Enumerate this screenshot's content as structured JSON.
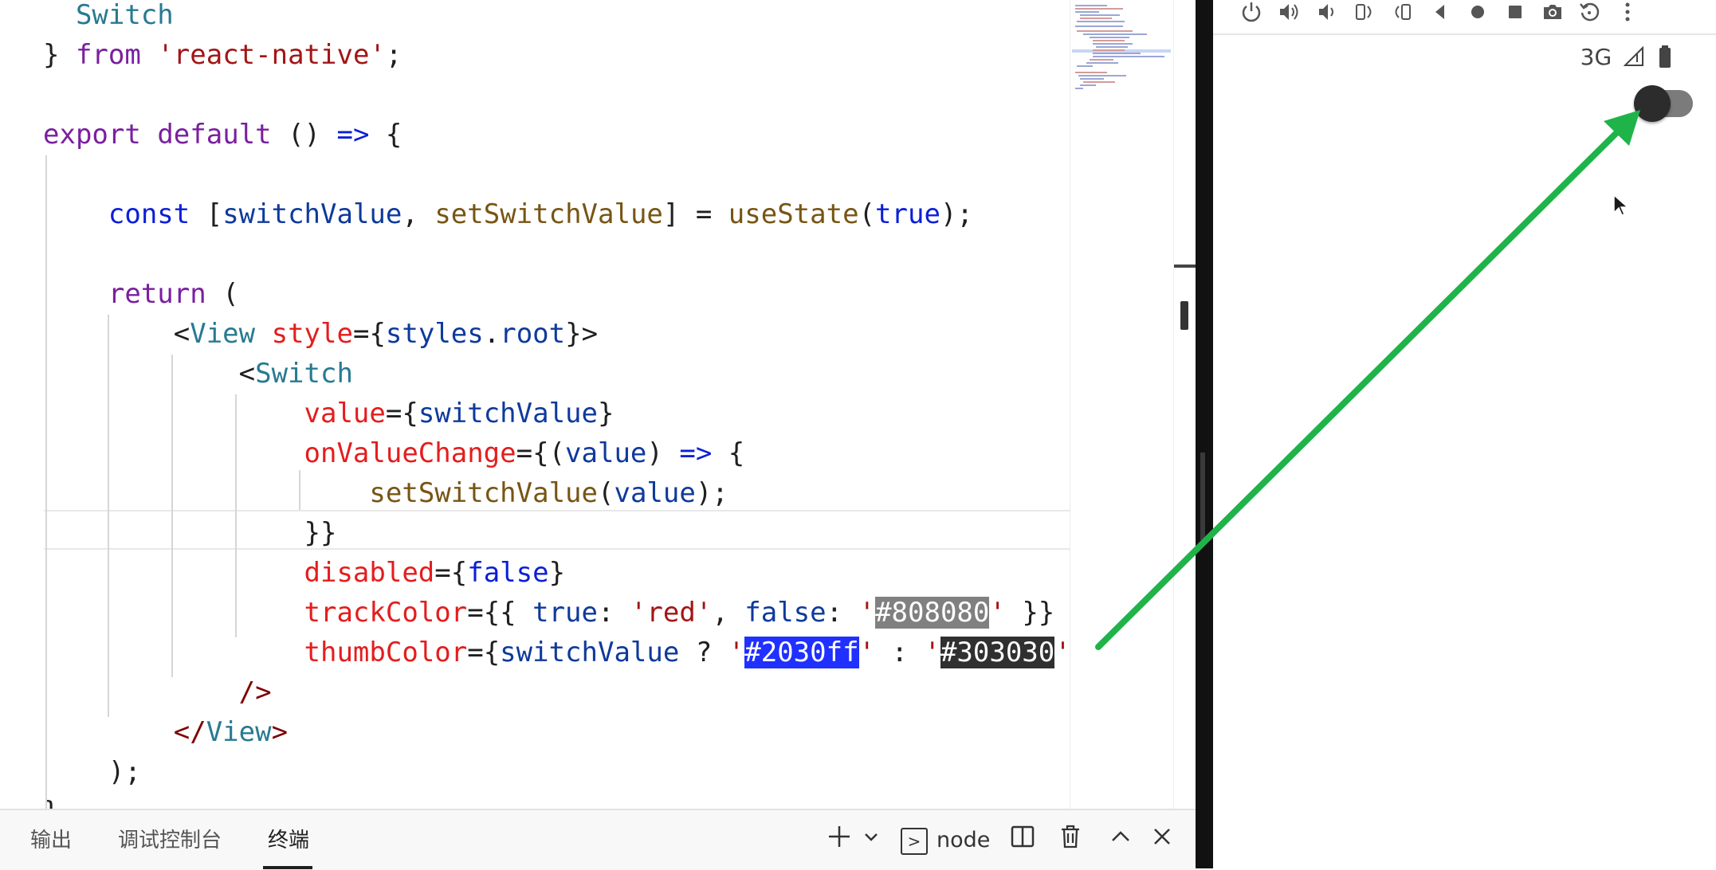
{
  "editor": {
    "lines": [
      {
        "segs": [
          {
            "t": "  Switch",
            "c": "t-comp"
          }
        ]
      },
      {
        "segs": [
          {
            "t": "} ",
            "c": "t-punc"
          },
          {
            "t": "from",
            "c": "t-kw"
          },
          {
            "t": " ",
            "c": "t-punc"
          },
          {
            "t": "'react-native'",
            "c": "t-str"
          },
          {
            "t": ";",
            "c": "t-punc"
          }
        ]
      },
      {
        "segs": []
      },
      {
        "segs": [
          {
            "t": "export",
            "c": "t-kw"
          },
          {
            "t": " ",
            "c": "t-punc"
          },
          {
            "t": "default",
            "c": "t-kw"
          },
          {
            "t": " () ",
            "c": "t-punc"
          },
          {
            "t": "=>",
            "c": "t-def"
          },
          {
            "t": " {",
            "c": "t-punc"
          }
        ]
      },
      {
        "segs": []
      },
      {
        "segs": [
          {
            "t": "    ",
            "c": "t-punc"
          },
          {
            "t": "const",
            "c": "t-def"
          },
          {
            "t": " [",
            "c": "t-punc"
          },
          {
            "t": "switchValue",
            "c": "t-var"
          },
          {
            "t": ", ",
            "c": "t-punc"
          },
          {
            "t": "setSwitchValue",
            "c": "t-fn"
          },
          {
            "t": "] = ",
            "c": "t-punc"
          },
          {
            "t": "useState",
            "c": "t-fn"
          },
          {
            "t": "(",
            "c": "t-punc"
          },
          {
            "t": "true",
            "c": "t-bool"
          },
          {
            "t": ");",
            "c": "t-punc"
          }
        ]
      },
      {
        "segs": []
      },
      {
        "segs": [
          {
            "t": "    ",
            "c": "t-punc"
          },
          {
            "t": "return",
            "c": "t-kw"
          },
          {
            "t": " (",
            "c": "t-punc"
          }
        ]
      },
      {
        "segs": [
          {
            "t": "        <",
            "c": "t-punc"
          },
          {
            "t": "View",
            "c": "t-comp"
          },
          {
            "t": " ",
            "c": "t-punc"
          },
          {
            "t": "style",
            "c": "t-attr"
          },
          {
            "t": "={",
            "c": "t-punc"
          },
          {
            "t": "styles",
            "c": "t-var"
          },
          {
            "t": ".",
            "c": "t-punc"
          },
          {
            "t": "root",
            "c": "t-var"
          },
          {
            "t": "}>",
            "c": "t-punc"
          }
        ]
      },
      {
        "segs": [
          {
            "t": "            <",
            "c": "t-punc"
          },
          {
            "t": "Switch",
            "c": "t-comp"
          }
        ]
      },
      {
        "segs": [
          {
            "t": "                ",
            "c": "t-punc"
          },
          {
            "t": "value",
            "c": "t-attr"
          },
          {
            "t": "={",
            "c": "t-punc"
          },
          {
            "t": "switchValue",
            "c": "t-var"
          },
          {
            "t": "}",
            "c": "t-punc"
          }
        ]
      },
      {
        "segs": [
          {
            "t": "                ",
            "c": "t-punc"
          },
          {
            "t": "onValueChange",
            "c": "t-attr"
          },
          {
            "t": "={(",
            "c": "t-punc"
          },
          {
            "t": "value",
            "c": "t-var"
          },
          {
            "t": ") ",
            "c": "t-punc"
          },
          {
            "t": "=>",
            "c": "t-def"
          },
          {
            "t": " {",
            "c": "t-punc"
          }
        ]
      },
      {
        "segs": [
          {
            "t": "                    ",
            "c": "t-punc"
          },
          {
            "t": "setSwitchValue",
            "c": "t-fn"
          },
          {
            "t": "(",
            "c": "t-punc"
          },
          {
            "t": "value",
            "c": "t-var"
          },
          {
            "t": ");",
            "c": "t-punc"
          }
        ]
      },
      {
        "segs": [
          {
            "t": "                }}",
            "c": "t-punc"
          }
        ]
      },
      {
        "segs": [
          {
            "t": "                ",
            "c": "t-punc"
          },
          {
            "t": "disabled",
            "c": "t-attr"
          },
          {
            "t": "={",
            "c": "t-punc"
          },
          {
            "t": "false",
            "c": "t-bool"
          },
          {
            "t": "}",
            "c": "t-punc"
          }
        ]
      },
      {
        "segs": [
          {
            "t": "                ",
            "c": "t-punc"
          },
          {
            "t": "trackColor",
            "c": "t-attr"
          },
          {
            "t": "={{ ",
            "c": "t-punc"
          },
          {
            "t": "true",
            "c": "t-var"
          },
          {
            "t": ": ",
            "c": "t-punc"
          },
          {
            "t": "'red'",
            "c": "t-str"
          },
          {
            "t": ", ",
            "c": "t-punc"
          },
          {
            "t": "false",
            "c": "t-var"
          },
          {
            "t": ": ",
            "c": "t-punc"
          },
          {
            "t": "'",
            "c": "t-str"
          },
          {
            "t": "#808080",
            "c": "hl-gray"
          },
          {
            "t": "'",
            "c": "t-str"
          },
          {
            "t": " }}",
            "c": "t-punc"
          }
        ]
      },
      {
        "segs": [
          {
            "t": "                ",
            "c": "t-punc"
          },
          {
            "t": "thumbColor",
            "c": "t-attr"
          },
          {
            "t": "={",
            "c": "t-punc"
          },
          {
            "t": "switchValue",
            "c": "t-var"
          },
          {
            "t": " ? ",
            "c": "t-punc"
          },
          {
            "t": "'",
            "c": "t-str"
          },
          {
            "t": "#2030ff",
            "c": "hl-blue"
          },
          {
            "t": "'",
            "c": "t-str"
          },
          {
            "t": " : ",
            "c": "t-punc"
          },
          {
            "t": "'",
            "c": "t-str"
          },
          {
            "t": "#303030",
            "c": "hl-dark"
          },
          {
            "t": "'",
            "c": "t-str"
          },
          {
            "t": "}",
            "c": "t-punc"
          }
        ]
      },
      {
        "segs": [
          {
            "t": "            />",
            "c": "t-tag"
          }
        ]
      },
      {
        "segs": [
          {
            "t": "        </",
            "c": "t-tag"
          },
          {
            "t": "View",
            "c": "t-comp"
          },
          {
            "t": ">",
            "c": "t-tag"
          }
        ]
      },
      {
        "segs": [
          {
            "t": "    );",
            "c": "t-punc"
          }
        ]
      },
      {
        "segs": [
          {
            "t": "}",
            "c": "t-punc"
          }
        ]
      }
    ]
  },
  "panel": {
    "tabs": [
      {
        "label": "输出"
      },
      {
        "label": "调试控制台"
      },
      {
        "label": "终端"
      }
    ],
    "active_tab": "终端",
    "terminal_name": "node",
    "icons": [
      "plus-icon",
      "chevron-down-icon",
      "terminal-icon",
      "split-icon",
      "trash-icon",
      "chevron-up-icon",
      "close-icon"
    ]
  },
  "emulator": {
    "toolbar_icons": [
      "power-icon",
      "volume-up-icon",
      "volume-down-icon",
      "rotate-left-icon",
      "rotate-right-icon",
      "back-icon",
      "home-icon",
      "overview-icon",
      "camera-icon",
      "replay-icon",
      "more-icon"
    ],
    "status": {
      "network": "3G"
    },
    "switch": {
      "on": true,
      "thumb_color": "#2c2c2c",
      "track_color": "#7b7b7b"
    }
  },
  "annotation": {
    "arrow_color": "#1fb34a"
  }
}
